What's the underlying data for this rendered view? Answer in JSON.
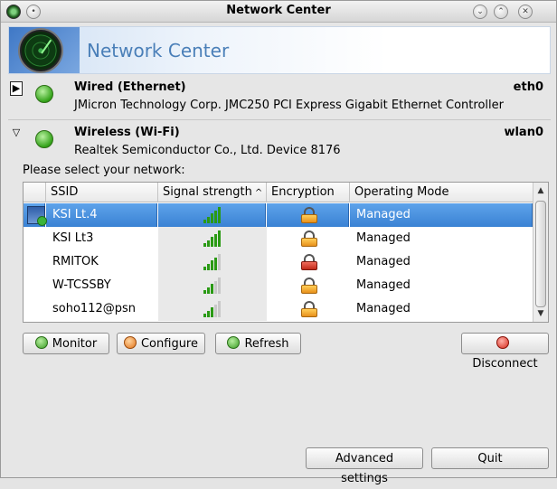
{
  "window": {
    "title": "Network Center"
  },
  "banner": {
    "title": "Network Center"
  },
  "wired": {
    "name": "Wired (Ethernet)",
    "interface": "eth0",
    "description": "JMicron Technology Corp. JMC250 PCI Express Gigabit Ethernet Controller"
  },
  "wireless": {
    "name": "Wireless (Wi-Fi)",
    "interface": "wlan0",
    "description": "Realtek Semiconductor Co., Ltd. Device 8176"
  },
  "prompt": "Please select your network:",
  "table": {
    "columns": [
      "SSID",
      "Signal strength",
      "Encryption",
      "Operating Mode"
    ],
    "rows": [
      {
        "ssid": "KSI Lt.4",
        "signal": 5,
        "encryption": "locked",
        "mode": "Managed",
        "selected": true
      },
      {
        "ssid": "KSI Lt3",
        "signal": 5,
        "encryption": "locked",
        "mode": "Managed",
        "selected": false
      },
      {
        "ssid": "RMITOK",
        "signal": 4,
        "encryption": "locked-red",
        "mode": "Managed",
        "selected": false
      },
      {
        "ssid": "W-TCSSBY",
        "signal": 3,
        "encryption": "locked",
        "mode": "Managed",
        "selected": false
      },
      {
        "ssid": "soho112@psn",
        "signal": 3,
        "encryption": "locked",
        "mode": "Managed",
        "selected": false
      }
    ]
  },
  "buttons": {
    "monitor": "Monitor",
    "configure": "Configure",
    "refresh": "Refresh",
    "disconnect": "Disconnect",
    "advanced": "Advanced settings",
    "quit": "Quit"
  },
  "colors": {
    "accent": "#3a82d4",
    "banner_title": "#4a7fb8",
    "signal_on": "#2a9a14",
    "signal_off": "#c8c8c8"
  }
}
